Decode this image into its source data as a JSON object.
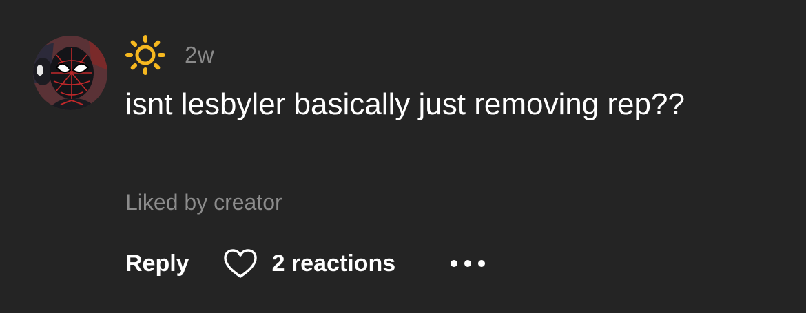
{
  "comment": {
    "avatar_icon": "spider-man-avatar",
    "user_icon": "sun-emoji",
    "timestamp": "2w",
    "text": "isnt lesbyler basically just removing rep??",
    "liked_by": "Liked by creator"
  },
  "actions": {
    "reply_label": "Reply",
    "reactions_label": "2 reactions",
    "heart_icon": "heart-outline-icon",
    "more_icon": "more-options-icon"
  },
  "colors": {
    "background": "#242424",
    "text": "#ffffff",
    "muted": "#8a8a8a",
    "sun": "#f6b81f"
  }
}
